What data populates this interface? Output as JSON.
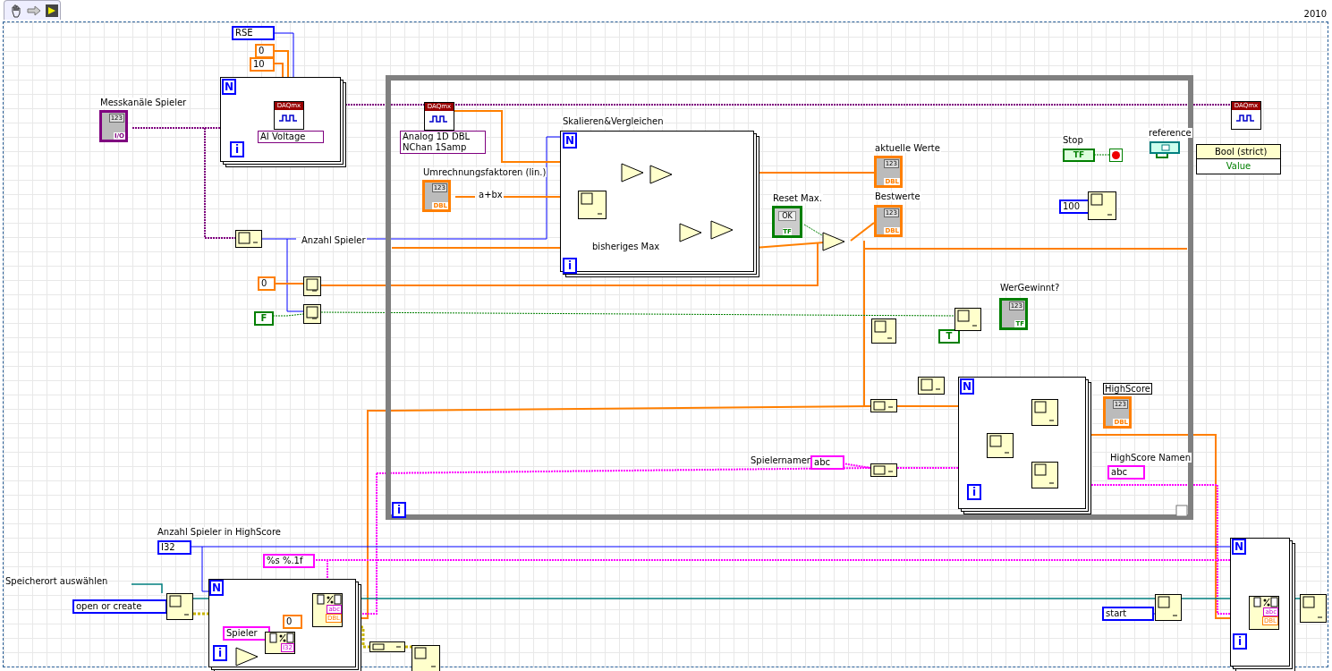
{
  "toolbar": {
    "version": "2010"
  },
  "loops": [
    {
      "kind": "for",
      "count": "N",
      "index": "i"
    },
    {
      "kind": "for",
      "count": "N",
      "index": "i"
    },
    {
      "kind": "for",
      "count": "N",
      "index": "i"
    },
    {
      "kind": "for",
      "count": "N",
      "index": "i"
    },
    {
      "kind": "for",
      "count": "N",
      "index": "i"
    },
    {
      "kind": "while",
      "index": "i"
    }
  ],
  "labels": [
    {
      "text": "Messkanäle Spieler"
    },
    {
      "text": "Skalieren&Vergleichen"
    },
    {
      "text": "Umrechnungsfaktoren (lin.)"
    },
    {
      "text": "a+bx"
    },
    {
      "text": "bisheriges Max"
    },
    {
      "text": "Anzahl Spieler"
    },
    {
      "text": "aktuelle Werte"
    },
    {
      "text": "Reset Max."
    },
    {
      "text": "Bestwerte"
    },
    {
      "text": "Stop"
    },
    {
      "text": "reference"
    },
    {
      "text": "WerGewinnt?"
    },
    {
      "text": "HighScore"
    },
    {
      "text": "Spielernamen"
    },
    {
      "text": "HighScore Namen"
    },
    {
      "text": "Anzahl Spieler in HighScore"
    },
    {
      "text": "Speicherort auswählen"
    }
  ],
  "constants": [
    {
      "kind": "enum",
      "value": "RSE"
    },
    {
      "kind": "numeric",
      "value": "0"
    },
    {
      "kind": "numeric",
      "value": "10"
    },
    {
      "kind": "ring",
      "value": "AI Voltage"
    },
    {
      "kind": "ring",
      "value": "Analog 1D DBL\nNChan 1Samp"
    },
    {
      "kind": "numeric",
      "value": "0"
    },
    {
      "kind": "boolean",
      "value": "F"
    },
    {
      "kind": "integer",
      "value": "100"
    },
    {
      "kind": "boolean",
      "value": "T"
    },
    {
      "kind": "string",
      "value": "abc"
    },
    {
      "kind": "string",
      "value": "abc"
    },
    {
      "kind": "integer",
      "value": "I32"
    },
    {
      "kind": "string",
      "value": "%s %.1f"
    },
    {
      "kind": "enum",
      "value": "open or create"
    },
    {
      "kind": "string",
      "value": "Spieler"
    },
    {
      "kind": "numeric",
      "value": "0"
    },
    {
      "kind": "enum",
      "value": "start"
    }
  ],
  "indicators": [
    {
      "kind": "io",
      "header": "123",
      "type": "I/O"
    },
    {
      "kind": "numeric",
      "header": "123",
      "type": "DBL"
    },
    {
      "kind": "numeric",
      "header": "123",
      "type": "DBL"
    },
    {
      "kind": "numeric",
      "header": "123",
      "type": "DBL"
    },
    {
      "kind": "boolean",
      "header": "123",
      "type": "TF"
    },
    {
      "kind": "numeric",
      "header": "123",
      "type": "DBL"
    }
  ],
  "booleans": [
    {
      "kind": "button",
      "text": "OK",
      "type": "TF"
    },
    {
      "kind": "switch",
      "text": "TF"
    }
  ],
  "daqmx_nodes": [
    {
      "header": "DAQmx"
    },
    {
      "header": "DAQmx"
    },
    {
      "header": "DAQmx"
    }
  ],
  "property_node": {
    "class": "Bool (strict)",
    "property": "Value"
  },
  "format_nodes": [
    {
      "inputs": [
        "abc",
        "DBL"
      ]
    },
    {
      "inputs": [
        "I32"
      ]
    },
    {
      "inputs": [
        "abc",
        "DBL"
      ]
    }
  ]
}
